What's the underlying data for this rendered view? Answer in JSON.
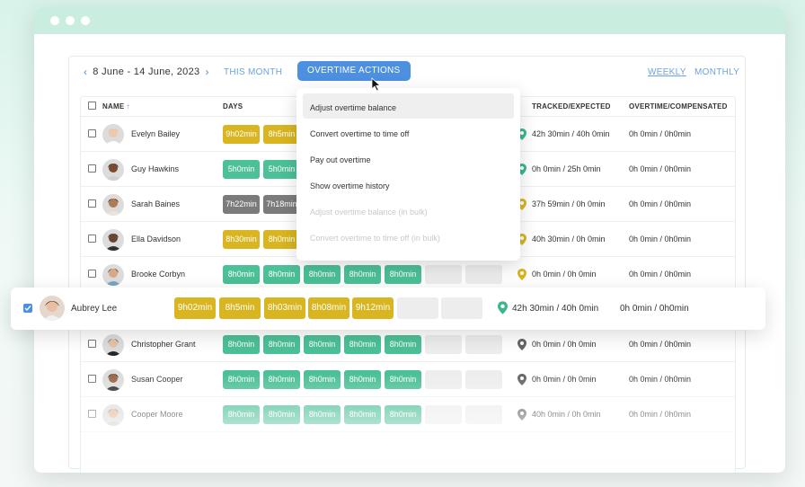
{
  "toolbar": {
    "date_range": "8 June - 14 June, 2023",
    "this_month": "THIS MONTH",
    "overtime_actions": "OVERTIME ACTIONS",
    "weekly": "WEEKLY",
    "monthly": "MONTHLY"
  },
  "table": {
    "headers": {
      "name": "NAME",
      "days": "DAYS",
      "tracked_expected": "TRACKED/EXPECTED",
      "overtime_compensated": "OVERTIME/COMPENSATED"
    }
  },
  "colors": {
    "yellow": "#d9b521",
    "green": "#4cc097",
    "gray": "#7b7b7b",
    "empty": "#ededed",
    "accent": "#4d8fe0",
    "pin_green": "#3ab88a",
    "pin_gray": "#666666"
  },
  "rows": [
    {
      "name": "Evelyn Bailey",
      "tracked": "42h 30min / 40h 0min",
      "overtime": "0h 0min / 0h0min",
      "pin": "green",
      "days": [
        {
          "t": "9h02min",
          "c": "yellow"
        },
        {
          "t": "8h5min",
          "c": "yellow"
        }
      ]
    },
    {
      "name": "Guy Hawkins",
      "tracked": "0h 0min / 25h 0min",
      "overtime": "0h 0min / 0h0min",
      "pin": "green",
      "days": [
        {
          "t": "5h0min",
          "c": "green"
        },
        {
          "t": "5h0min",
          "c": "green"
        }
      ]
    },
    {
      "name": "Sarah Baines",
      "tracked": "37h 59min / 0h 0min",
      "overtime": "0h 0min / 0h0min",
      "pin": "yellow",
      "days": [
        {
          "t": "7h22min",
          "c": "gray"
        },
        {
          "t": "7h18min",
          "c": "gray"
        }
      ]
    },
    {
      "name": "Ella Davidson",
      "tracked": "40h 30min / 0h 0min",
      "overtime": "0h 0min / 0h0min",
      "pin": "yellow",
      "days": [
        {
          "t": "8h30min",
          "c": "yellow"
        },
        {
          "t": "8h0min",
          "c": "yellow"
        }
      ]
    },
    {
      "name": "Brooke Corbyn",
      "tracked": "0h 0min / 0h 0min",
      "overtime": "0h 0min / 0h0min",
      "pin": "yellow",
      "days": [
        {
          "t": "8h0min",
          "c": "green"
        },
        {
          "t": "8h0min",
          "c": "green"
        },
        {
          "t": "8h0min",
          "c": "green"
        },
        {
          "t": "8h0min",
          "c": "green"
        },
        {
          "t": "8h0min",
          "c": "green"
        },
        {
          "t": "",
          "c": "empty"
        },
        {
          "t": "",
          "c": "empty"
        }
      ]
    },
    {
      "name": "",
      "tracked": "",
      "overtime": "",
      "pin": "none",
      "days": []
    },
    {
      "name": "Christopher Grant",
      "tracked": "0h 0min / 0h 0min",
      "overtime": "0h 0min / 0h0min",
      "pin": "gray",
      "days": [
        {
          "t": "8h0min",
          "c": "green"
        },
        {
          "t": "8h0min",
          "c": "green"
        },
        {
          "t": "8h0min",
          "c": "green"
        },
        {
          "t": "8h0min",
          "c": "green"
        },
        {
          "t": "8h0min",
          "c": "green"
        },
        {
          "t": "",
          "c": "empty"
        },
        {
          "t": "",
          "c": "empty"
        }
      ]
    },
    {
      "name": "Susan Cooper",
      "tracked": "0h 0min / 0h 0min",
      "overtime": "0h 0min / 0h0min",
      "pin": "gray",
      "days": [
        {
          "t": "8h0min",
          "c": "green"
        },
        {
          "t": "8h0min",
          "c": "green"
        },
        {
          "t": "8h0min",
          "c": "green"
        },
        {
          "t": "8h0min",
          "c": "green"
        },
        {
          "t": "8h0min",
          "c": "green"
        },
        {
          "t": "",
          "c": "empty"
        },
        {
          "t": "",
          "c": "empty"
        }
      ]
    },
    {
      "name": "Cooper Moore",
      "tracked": "40h 0min / 0h 0min",
      "overtime": "0h 0min / 0h0min",
      "pin": "gray",
      "days": [
        {
          "t": "8h0min",
          "c": "green"
        },
        {
          "t": "8h0min",
          "c": "green"
        },
        {
          "t": "8h0min",
          "c": "green"
        },
        {
          "t": "8h0min",
          "c": "green"
        },
        {
          "t": "8h0min",
          "c": "green"
        },
        {
          "t": "",
          "c": "empty"
        },
        {
          "t": "",
          "c": "empty"
        }
      ]
    }
  ],
  "highlighted_row": {
    "name": "Aubrey Lee",
    "tracked": "42h 30min / 40h 0min",
    "overtime": "0h 0min / 0h0min",
    "days": [
      {
        "t": "9h02min",
        "c": "yellow"
      },
      {
        "t": "8h5min",
        "c": "yellow"
      },
      {
        "t": "8h03min",
        "c": "yellow"
      },
      {
        "t": "8h08min",
        "c": "yellow"
      },
      {
        "t": "9h12min",
        "c": "yellow"
      },
      {
        "t": "",
        "c": "empty"
      },
      {
        "t": "",
        "c": "empty"
      }
    ]
  },
  "dropdown": {
    "items": [
      {
        "label": "Adjust overtime balance",
        "state": "active"
      },
      {
        "label": "Convert overtime to time off",
        "state": "normal"
      },
      {
        "label": "Pay out overtime",
        "state": "normal"
      },
      {
        "label": "Show overtime history",
        "state": "normal"
      },
      {
        "label": "Adjust overtime balance (in bulk)",
        "state": "disabled"
      },
      {
        "label": "Convert overtime  to time off (in bulk)",
        "state": "disabled"
      }
    ]
  }
}
